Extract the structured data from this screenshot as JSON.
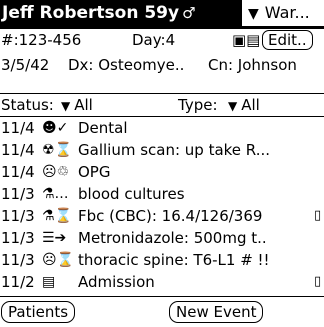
{
  "header": {
    "title": "Jeff Robertson 59y",
    "gender_symbol": "♂",
    "ward_label": "War..."
  },
  "patient": {
    "id": "#:123-456",
    "day": "Day:4",
    "edit_label": "Edit..",
    "dob": "3/5/42",
    "dx": "Dx: Osteomye..",
    "cn": "Cn: Johnson"
  },
  "filters": {
    "status_label": "Status:",
    "status_value": "All",
    "type_label": "Type:",
    "type_value": "All"
  },
  "events": [
    {
      "date": "11/4",
      "icons": "☻✓",
      "text": "Dental",
      "flag": ""
    },
    {
      "date": "11/4",
      "icons": "☢⌛",
      "text": "Gallium scan: up take R...",
      "flag": ""
    },
    {
      "date": "11/4",
      "icons": "☹♲",
      "text": "OPG",
      "flag": ""
    },
    {
      "date": "11/3",
      "icons": "⚗…",
      "text": "blood cultures",
      "flag": ""
    },
    {
      "date": "11/3",
      "icons": "⚗⌛",
      "text": "Fbc (CBC): 16.4/126/369",
      "flag": "▯"
    },
    {
      "date": "11/3",
      "icons": "☰➔",
      "text": "Metronidazole: 500mg t..",
      "flag": ""
    },
    {
      "date": "11/3",
      "icons": "☹⌛",
      "text": "thoracic spine: T6-L1 # !!",
      "flag": ""
    },
    {
      "date": "11/2",
      "icons": "▤",
      "text": "Admission",
      "flag": "▯"
    }
  ],
  "footer": {
    "patients_label": "Patients",
    "new_event_label": "New Event"
  }
}
